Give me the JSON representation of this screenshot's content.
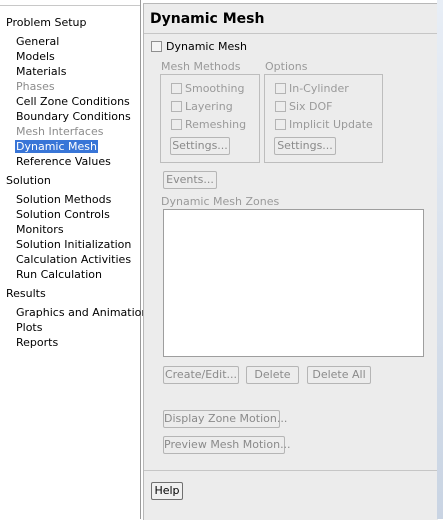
{
  "tree": {
    "problem_setup": "Problem Setup",
    "setup_items": [
      {
        "label": "General",
        "state": "normal"
      },
      {
        "label": "Models",
        "state": "normal"
      },
      {
        "label": "Materials",
        "state": "normal"
      },
      {
        "label": "Phases",
        "state": "disabled"
      },
      {
        "label": "Cell Zone Conditions",
        "state": "normal"
      },
      {
        "label": "Boundary Conditions",
        "state": "normal"
      },
      {
        "label": "Mesh Interfaces",
        "state": "disabled"
      },
      {
        "label": "Dynamic Mesh",
        "state": "selected"
      },
      {
        "label": "Reference Values",
        "state": "normal"
      }
    ],
    "solution": "Solution",
    "solution_items": [
      {
        "label": "Solution Methods"
      },
      {
        "label": "Solution Controls"
      },
      {
        "label": "Monitors"
      },
      {
        "label": "Solution Initialization"
      },
      {
        "label": "Calculation Activities"
      },
      {
        "label": "Run Calculation"
      }
    ],
    "results": "Results",
    "results_items": [
      {
        "label": "Graphics and Animations"
      },
      {
        "label": "Plots"
      },
      {
        "label": "Reports"
      }
    ]
  },
  "panel": {
    "title": "Dynamic Mesh",
    "dynamic_mesh_checkbox": {
      "label": "Dynamic Mesh",
      "checked": false
    },
    "mesh_methods": {
      "title": "Mesh Methods",
      "options": [
        {
          "label": "Smoothing",
          "checked": false
        },
        {
          "label": "Layering",
          "checked": false
        },
        {
          "label": "Remeshing",
          "checked": false
        }
      ],
      "settings_button": "Settings..."
    },
    "options": {
      "title": "Options",
      "options": [
        {
          "label": "In-Cylinder",
          "checked": false
        },
        {
          "label": "Six DOF",
          "checked": false
        },
        {
          "label": "Implicit Update",
          "checked": false
        }
      ],
      "settings_button": "Settings..."
    },
    "events_button": "Events...",
    "zones": {
      "title": "Dynamic Mesh Zones",
      "items": [],
      "create_edit_button": "Create/Edit...",
      "delete_button": "Delete",
      "delete_all_button": "Delete All"
    },
    "display_zone_motion_button": "Display Zone Motion...",
    "preview_mesh_motion_button": "Preview Mesh Motion...",
    "help_button": "Help"
  }
}
